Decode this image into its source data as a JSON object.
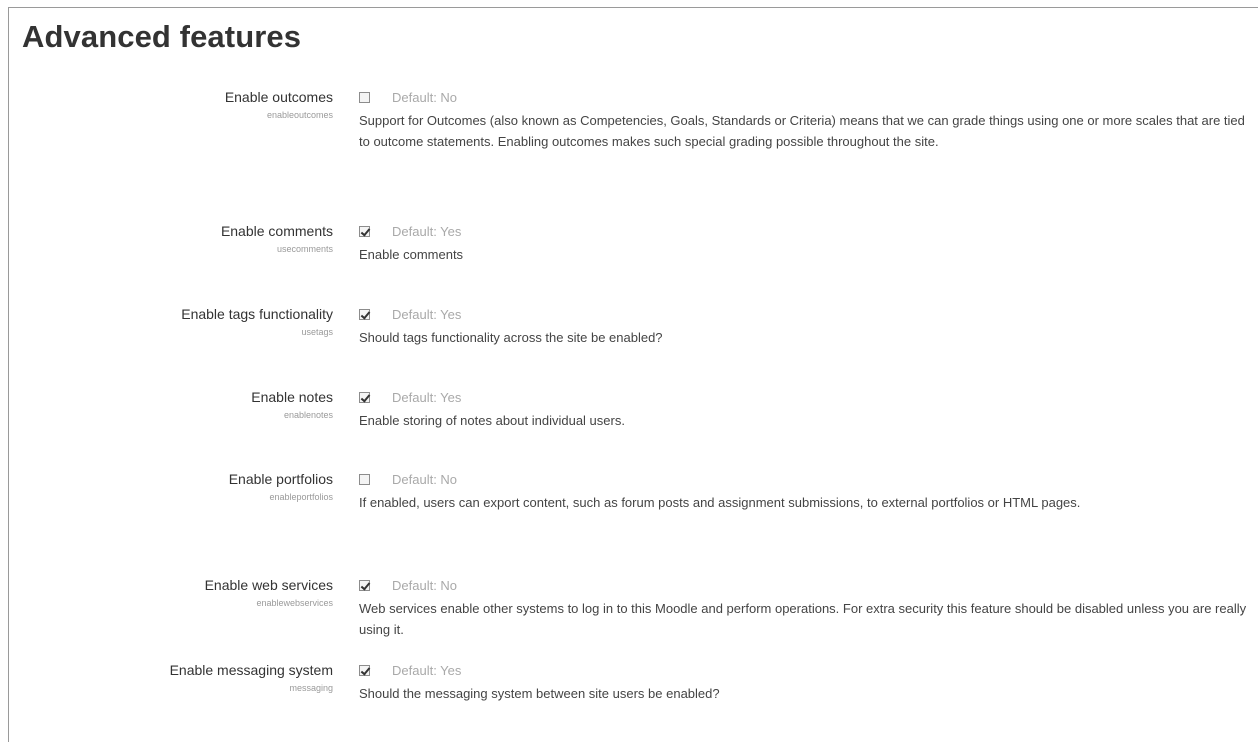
{
  "page": {
    "title": "Advanced features"
  },
  "settings": [
    {
      "label": "Enable outcomes",
      "key": "enableoutcomes",
      "checked": false,
      "default_text": "Default: No",
      "description": "Support for Outcomes (also known as Competencies, Goals, Standards or Criteria) means that we can grade things using one or more scales that are tied to outcome statements. Enabling outcomes makes such special grading possible throughout the site."
    },
    {
      "label": "Enable comments",
      "key": "usecomments",
      "checked": true,
      "default_text": "Default: Yes",
      "description": "Enable comments"
    },
    {
      "label": "Enable tags functionality",
      "key": "usetags",
      "checked": true,
      "default_text": "Default: Yes",
      "description": "Should tags functionality across the site be enabled?"
    },
    {
      "label": "Enable notes",
      "key": "enablenotes",
      "checked": true,
      "default_text": "Default: Yes",
      "description": "Enable storing of notes about individual users."
    },
    {
      "label": "Enable portfolios",
      "key": "enableportfolios",
      "checked": false,
      "default_text": "Default: No",
      "description": "If enabled, users can export content, such as forum posts and assignment submissions, to external portfolios or HTML pages."
    },
    {
      "label": "Enable web services",
      "key": "enablewebservices",
      "checked": true,
      "default_text": "Default: No",
      "description": "Web services enable other systems to log in to this Moodle and perform operations. For extra security this feature should be disabled unless you are really using it."
    },
    {
      "label": "Enable messaging system",
      "key": "messaging",
      "checked": true,
      "default_text": "Default: Yes",
      "description": "Should the messaging system between site users be enabled?"
    }
  ]
}
